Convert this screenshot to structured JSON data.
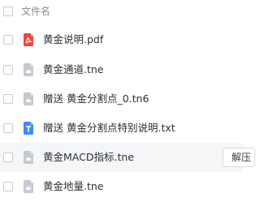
{
  "header": {
    "column_label": "文件名"
  },
  "files": [
    {
      "name": "黄金说明.pdf",
      "icon": "pdf-file-icon"
    },
    {
      "name": "黄金通道.tne",
      "icon": "generic-file-icon"
    },
    {
      "name": "赠送 黄金分割点_0.tn6",
      "icon": "generic-file-icon"
    },
    {
      "name": "赠送 黄金分割点特别说明.txt",
      "icon": "text-file-icon"
    },
    {
      "name": "黄金MACD指标.tne",
      "icon": "generic-file-icon",
      "action_label": "解压"
    },
    {
      "name": "黄金地量.tne",
      "icon": "generic-file-icon"
    }
  ],
  "colors": {
    "pdf_icon": "#f0443c",
    "text_icon": "#3d8af7",
    "generic_icon": "#c5cad1",
    "hover_row": "#f5f6f8"
  }
}
